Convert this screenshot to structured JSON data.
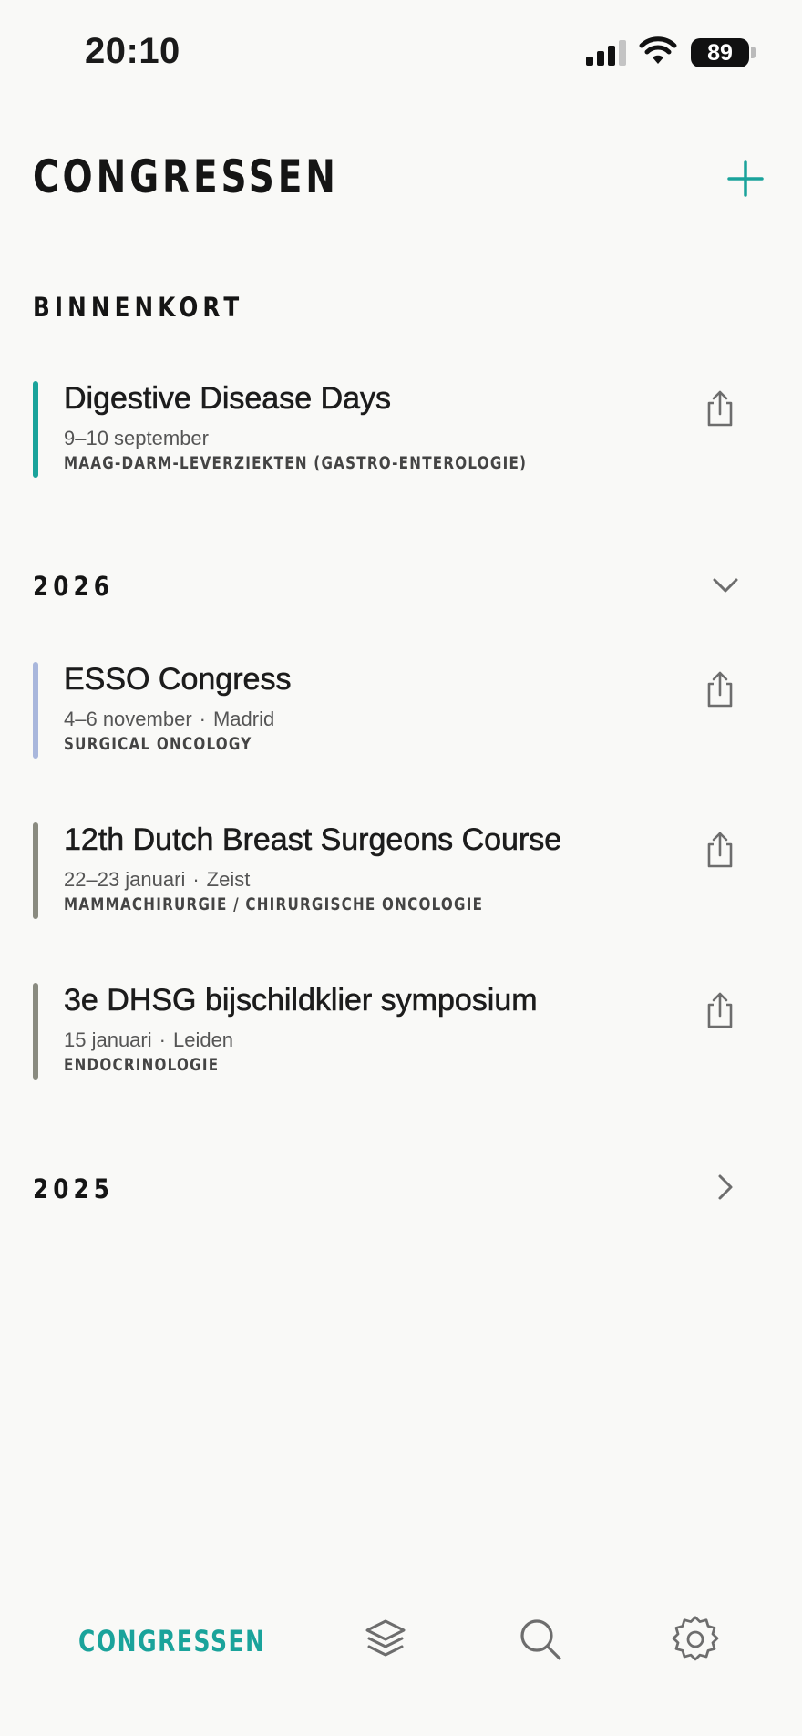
{
  "status_bar": {
    "time": "20:10",
    "battery": "89"
  },
  "header": {
    "title": "CONGRESSEN",
    "add_icon": "plus-icon"
  },
  "colors": {
    "accent": "#1aa39b",
    "bar_teal": "#1aa39b",
    "bar_lavender": "#a9b7dc",
    "bar_grey": "#8a8b80"
  },
  "sections": {
    "upcoming": {
      "title": "BINNENKORT",
      "items": [
        {
          "title": "Digestive Disease Days",
          "date": "9–10 september",
          "location": "",
          "tag": "MAAG-DARM-LEVERZIEKTEN (GASTRO-ENTEROLOGIE)",
          "color": "#1aa39b"
        }
      ]
    },
    "y2026": {
      "title": "2026",
      "expanded": true,
      "items": [
        {
          "title": "ESSO Congress",
          "date": "4–6 november",
          "location": "Madrid",
          "tag": "SURGICAL ONCOLOGY",
          "color": "#a9b7dc"
        },
        {
          "title": "12th Dutch Breast Surgeons Course",
          "date": "22–23 januari",
          "location": "Zeist",
          "tag": "MAMMACHIRURGIE / CHIRURGISCHE ONCOLOGIE",
          "color": "#8a8b80"
        },
        {
          "title": "3e DHSG bijschildklier symposium",
          "date": "15 januari",
          "location": "Leiden",
          "tag": "ENDOCRINOLOGIE",
          "color": "#8a8b80"
        }
      ]
    },
    "y2025": {
      "title": "2025",
      "expanded": false
    }
  },
  "tabbar": {
    "active_label": "CONGRESSEN",
    "icons": [
      "layers-icon",
      "search-icon",
      "gear-icon"
    ]
  },
  "separator": "·"
}
